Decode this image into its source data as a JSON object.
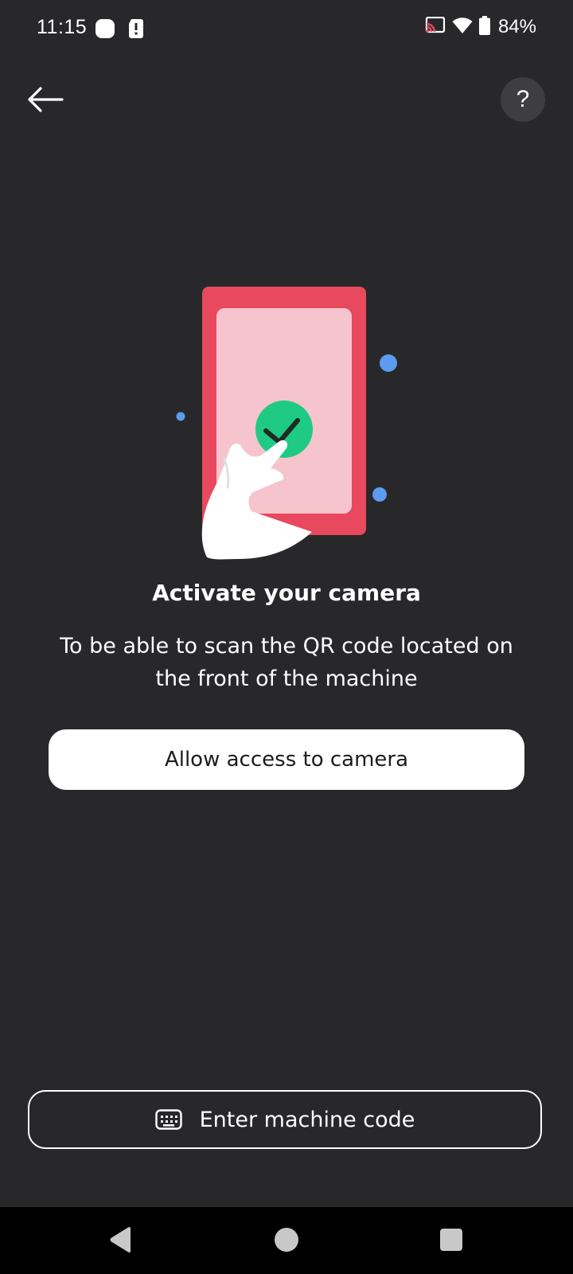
{
  "status_bar": {
    "time": "11:15",
    "battery_percent": "84%",
    "icons": [
      "notification-icon",
      "alert-icon",
      "cast-icon",
      "wifi-icon",
      "battery-icon"
    ]
  },
  "header": {
    "back_icon": "arrow-left-icon",
    "help_label": "?"
  },
  "illustration": {
    "description_icon": "phone-tap-checkmark-icon",
    "colors": {
      "phone_body": "#e8495e",
      "phone_screen": "#f6c4cc",
      "check_circle": "#1fca84",
      "dots": "#5b9bf0",
      "hand": "#ffffff"
    }
  },
  "content": {
    "title": "Activate your camera",
    "description": "To be able to scan the QR code located on the front of the machine",
    "allow_button_label": "Allow access to camera"
  },
  "footer": {
    "enter_code_label": "Enter machine code",
    "enter_code_icon": "keyboard-icon"
  },
  "nav_bar": {
    "icons": [
      "nav-back-icon",
      "nav-home-icon",
      "nav-recents-icon"
    ]
  },
  "colors": {
    "background": "#28282a",
    "primary_button_bg": "#ffffff",
    "primary_button_text": "#1c1c1e",
    "help_button_bg": "#3e3e41"
  }
}
